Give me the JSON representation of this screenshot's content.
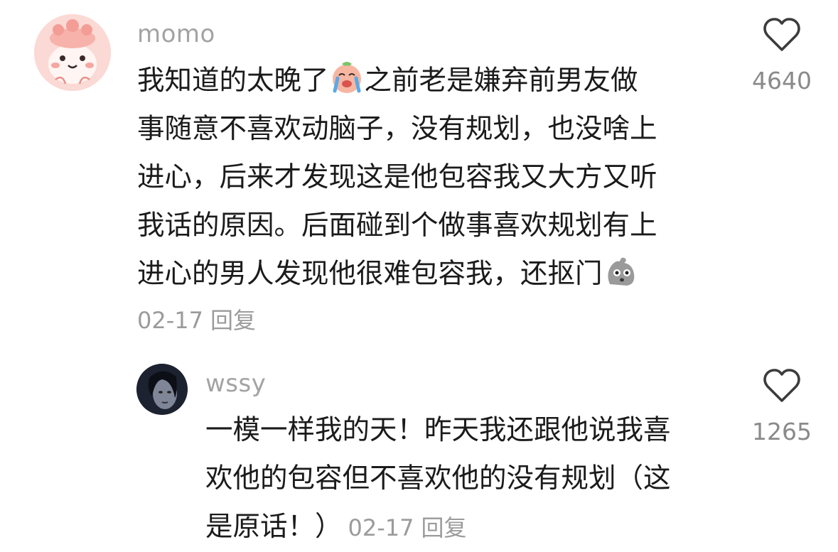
{
  "comment": {
    "username": "momo",
    "avatar": "pink-cartoon-avatar",
    "lines": [
      "我知道的太晚了",
      "之前老是嫌弃前男友做",
      "事随意不喜欢动脑子，没有规划，也没啥上",
      "进心，后来才发现这是他包容我又大方又听",
      "我话的原因。后面碰到个做事喜欢规划有上",
      "进心的男人发现他很难包容我，还抠门"
    ],
    "emoji_1": "crying-face-icon",
    "emoji_2": "shocked-rock-icon",
    "date": "02-17",
    "reply_label": "回复",
    "like_count": "4640",
    "like_icon": "heart-outline-icon"
  },
  "reply": {
    "username": "wssy",
    "avatar": "dark-photo-avatar",
    "lines": [
      "一模一样我的天！昨天我还跟他说我喜",
      "欢他的包容但不喜欢他的没有规划（这",
      "是原话！）"
    ],
    "date": "02-17",
    "reply_label": "回复",
    "like_count": "1265",
    "like_icon": "heart-outline-icon"
  },
  "colors": {
    "text": "#1b1b1b",
    "muted": "#9b9b9b",
    "username": "#a3a3a3"
  }
}
